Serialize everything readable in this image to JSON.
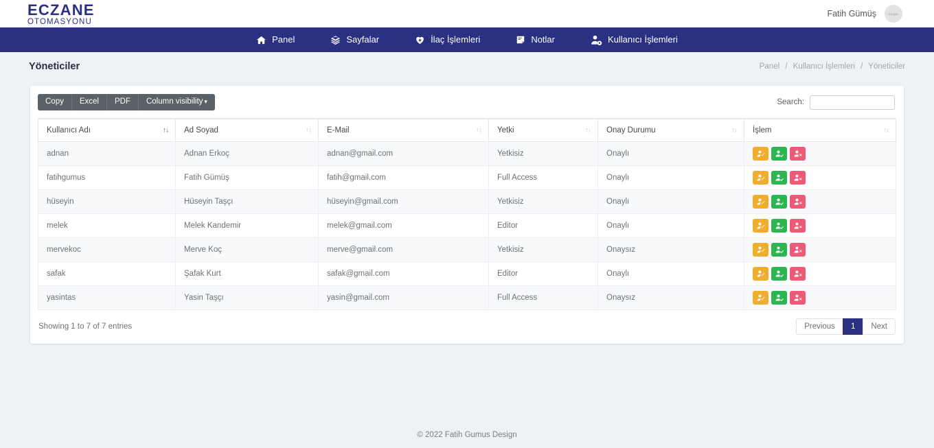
{
  "brand": {
    "line1": "ECZANE",
    "line2": "OTOMASYONU",
    "color": "#2b3180"
  },
  "topbar": {
    "username": "Fatih Gümüş",
    "avatar_placeholder": "image"
  },
  "nav": {
    "items": [
      {
        "label": "Panel",
        "icon": "home-icon"
      },
      {
        "label": "Sayfalar",
        "icon": "layers-icon"
      },
      {
        "label": "İlaç İşlemleri",
        "icon": "heart-icon"
      },
      {
        "label": "Notlar",
        "icon": "note-icon"
      },
      {
        "label": "Kullanıcı İşlemleri",
        "icon": "user-gear-icon"
      }
    ],
    "background": "#2b3180"
  },
  "page": {
    "title": "Yöneticiler",
    "breadcrumb": [
      "Panel",
      "Kullanıcı İşlemleri",
      "Yöneticiler"
    ],
    "breadcrumb_separator": "/"
  },
  "toolbar": {
    "copy_label": "Copy",
    "excel_label": "Excel",
    "pdf_label": "PDF",
    "column_visibility_label": "Column visibility",
    "caret": "▾"
  },
  "search": {
    "label": "Search:",
    "value": "",
    "placeholder": ""
  },
  "table": {
    "columns": [
      {
        "label": "Kullanıcı Adı",
        "sorted": true,
        "sort_dir": "asc"
      },
      {
        "label": "Ad Soyad",
        "sorted": false
      },
      {
        "label": "E-Mail",
        "sorted": false
      },
      {
        "label": "Yetki",
        "sorted": false
      },
      {
        "label": "Onay Durumu",
        "sorted": false
      },
      {
        "label": "İşlem",
        "sorted": false
      }
    ],
    "rows": [
      {
        "username": "adnan",
        "fullname": "Adnan Erkoç",
        "email": "adnan@gmail.com",
        "role": "Yetkisiz",
        "status": "Onaylı"
      },
      {
        "username": "fatihgumus",
        "fullname": "Fatih Gümüş",
        "email": "fatih@gmail.com",
        "role": "Full Access",
        "status": "Onaylı"
      },
      {
        "username": "hüseyin",
        "fullname": "Hüseyin Taşçı",
        "email": "hüseyin@gmail.com",
        "role": "Yetkisiz",
        "status": "Onaylı"
      },
      {
        "username": "melek",
        "fullname": "Melek Kandemir",
        "email": "melek@gmail.com",
        "role": "Editor",
        "status": "Onaylı"
      },
      {
        "username": "mervekoc",
        "fullname": "Merve Koç",
        "email": "merve@gmail.com",
        "role": "Yetkisiz",
        "status": "Onaysız"
      },
      {
        "username": "safak",
        "fullname": "Şafak Kurt",
        "email": "safak@gmail.com",
        "role": "Editor",
        "status": "Onaylı"
      },
      {
        "username": "yasintas",
        "fullname": "Yasin Taşçı",
        "email": "yasin@gmail.com",
        "role": "Full Access",
        "status": "Onaysız"
      }
    ],
    "action_buttons": [
      {
        "name": "user-edit-icon",
        "color": "#f0ad2e"
      },
      {
        "name": "user-check-icon",
        "color": "#2cb551"
      },
      {
        "name": "user-delete-icon",
        "color": "#ed5a78"
      }
    ]
  },
  "pagination": {
    "info": "Showing 1 to 7 of 7 entries",
    "previous_label": "Previous",
    "next_label": "Next",
    "pages": [
      "1"
    ],
    "active_page": "1"
  },
  "footer": {
    "text": "© 2022 Fatih Gumus Design"
  }
}
